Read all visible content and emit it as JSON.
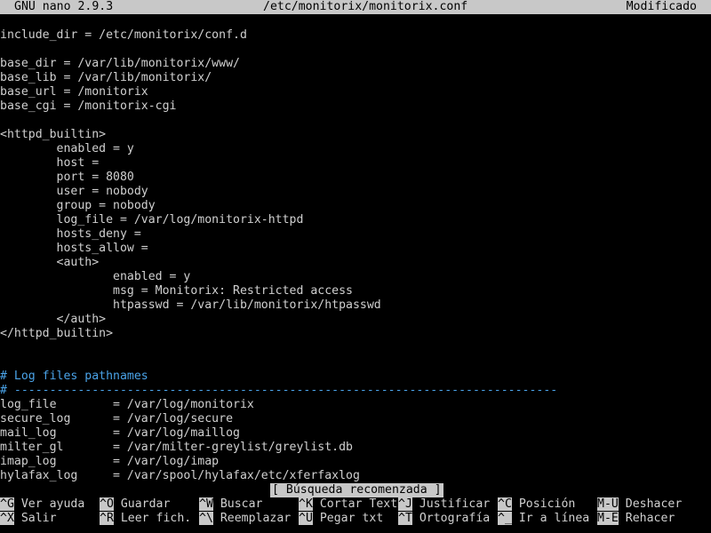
{
  "titlebar": {
    "app": "GNU nano 2.9.3",
    "file": "/etc/monitorix/monitorix.conf",
    "status": "Modificado"
  },
  "editor": {
    "lines": [
      {
        "text": "include_dir = /etc/monitorix/conf.d",
        "type": "text"
      },
      {
        "text": "",
        "type": "text"
      },
      {
        "text": "base_dir = /var/lib/monitorix/www/",
        "type": "text"
      },
      {
        "text": "base_lib = /var/lib/monitorix/",
        "type": "text"
      },
      {
        "text": "base_url = /monitorix",
        "type": "text"
      },
      {
        "text": "base_cgi = /monitorix-cgi",
        "type": "text"
      },
      {
        "text": "",
        "type": "text"
      },
      {
        "text": "<httpd_builtin>",
        "type": "text"
      },
      {
        "text": "        enabled = y",
        "type": "text"
      },
      {
        "text": "        host =",
        "type": "text"
      },
      {
        "text": "        port = 8080",
        "type": "text"
      },
      {
        "text": "        user = nobody",
        "type": "text"
      },
      {
        "text": "        group = nobody",
        "type": "text"
      },
      {
        "text": "        log_file = /var/log/monitorix-httpd",
        "type": "text"
      },
      {
        "text": "        hosts_deny =",
        "type": "text"
      },
      {
        "text": "        hosts_allow =",
        "type": "text"
      },
      {
        "text": "        <auth>",
        "type": "text"
      },
      {
        "text": "                enabled = y",
        "type": "text"
      },
      {
        "text": "                msg = Monitorix: Restricted access",
        "type": "text"
      },
      {
        "text": "                htpasswd = /var/lib/monitorix/htpasswd",
        "type": "text"
      },
      {
        "text": "        </auth>",
        "type": "text"
      },
      {
        "text": "</httpd_builtin>",
        "type": "text"
      },
      {
        "text": "",
        "type": "text"
      },
      {
        "text": "",
        "type": "text"
      },
      {
        "text": "# Log files pathnames",
        "type": "comment"
      },
      {
        "text": "# -----------------------------------------------------------------------------",
        "type": "comment"
      },
      {
        "text": "log_file        = /var/log/monitorix",
        "type": "text"
      },
      {
        "text": "secure_log      = /var/log/secure",
        "type": "text"
      },
      {
        "text": "mail_log        = /var/log/maillog",
        "type": "text"
      },
      {
        "text": "milter_gl       = /var/milter-greylist/greylist.db",
        "type": "text"
      },
      {
        "text": "imap_log        = /var/log/imap",
        "type": "text"
      },
      {
        "text": "hylafax_log     = /var/spool/hylafax/etc/xferfaxlog",
        "type": "text"
      }
    ]
  },
  "status_message": "[ Búsqueda recomenzada ]",
  "shortcuts": [
    {
      "key": "^G",
      "label": " Ver ayuda",
      "name": "shortcut-ver-ayuda"
    },
    {
      "key": "^O",
      "label": " Guardar",
      "name": "shortcut-guardar"
    },
    {
      "key": "^W",
      "label": " Buscar",
      "name": "shortcut-buscar"
    },
    {
      "key": "^K",
      "label": " Cortar Text",
      "name": "shortcut-cortar-text"
    },
    {
      "key": "^J",
      "label": " Justificar",
      "name": "shortcut-justificar"
    },
    {
      "key": "^C",
      "label": " Posición",
      "name": "shortcut-posicion"
    },
    {
      "key": "M-U",
      "label": " Deshacer",
      "name": "shortcut-deshacer"
    },
    {
      "key": "^X",
      "label": " Salir",
      "name": "shortcut-salir"
    },
    {
      "key": "^R",
      "label": " Leer fich.",
      "name": "shortcut-leer-fich"
    },
    {
      "key": "^\\",
      "label": " Reemplazar",
      "name": "shortcut-reemplazar"
    },
    {
      "key": "^U",
      "label": " Pegar txt",
      "name": "shortcut-pegar-txt"
    },
    {
      "key": "^T",
      "label": " Ortografía",
      "name": "shortcut-ortografia"
    },
    {
      "key": "^_",
      "label": " Ir a línea",
      "name": "shortcut-ir-a-linea"
    },
    {
      "key": "M-E",
      "label": " Rehacer",
      "name": "shortcut-rehacer"
    }
  ],
  "colors": {
    "background": "#000000",
    "text": "#d0d0d0",
    "inverse_bg": "#c8c8c8",
    "comment": "#4aa3e8"
  }
}
